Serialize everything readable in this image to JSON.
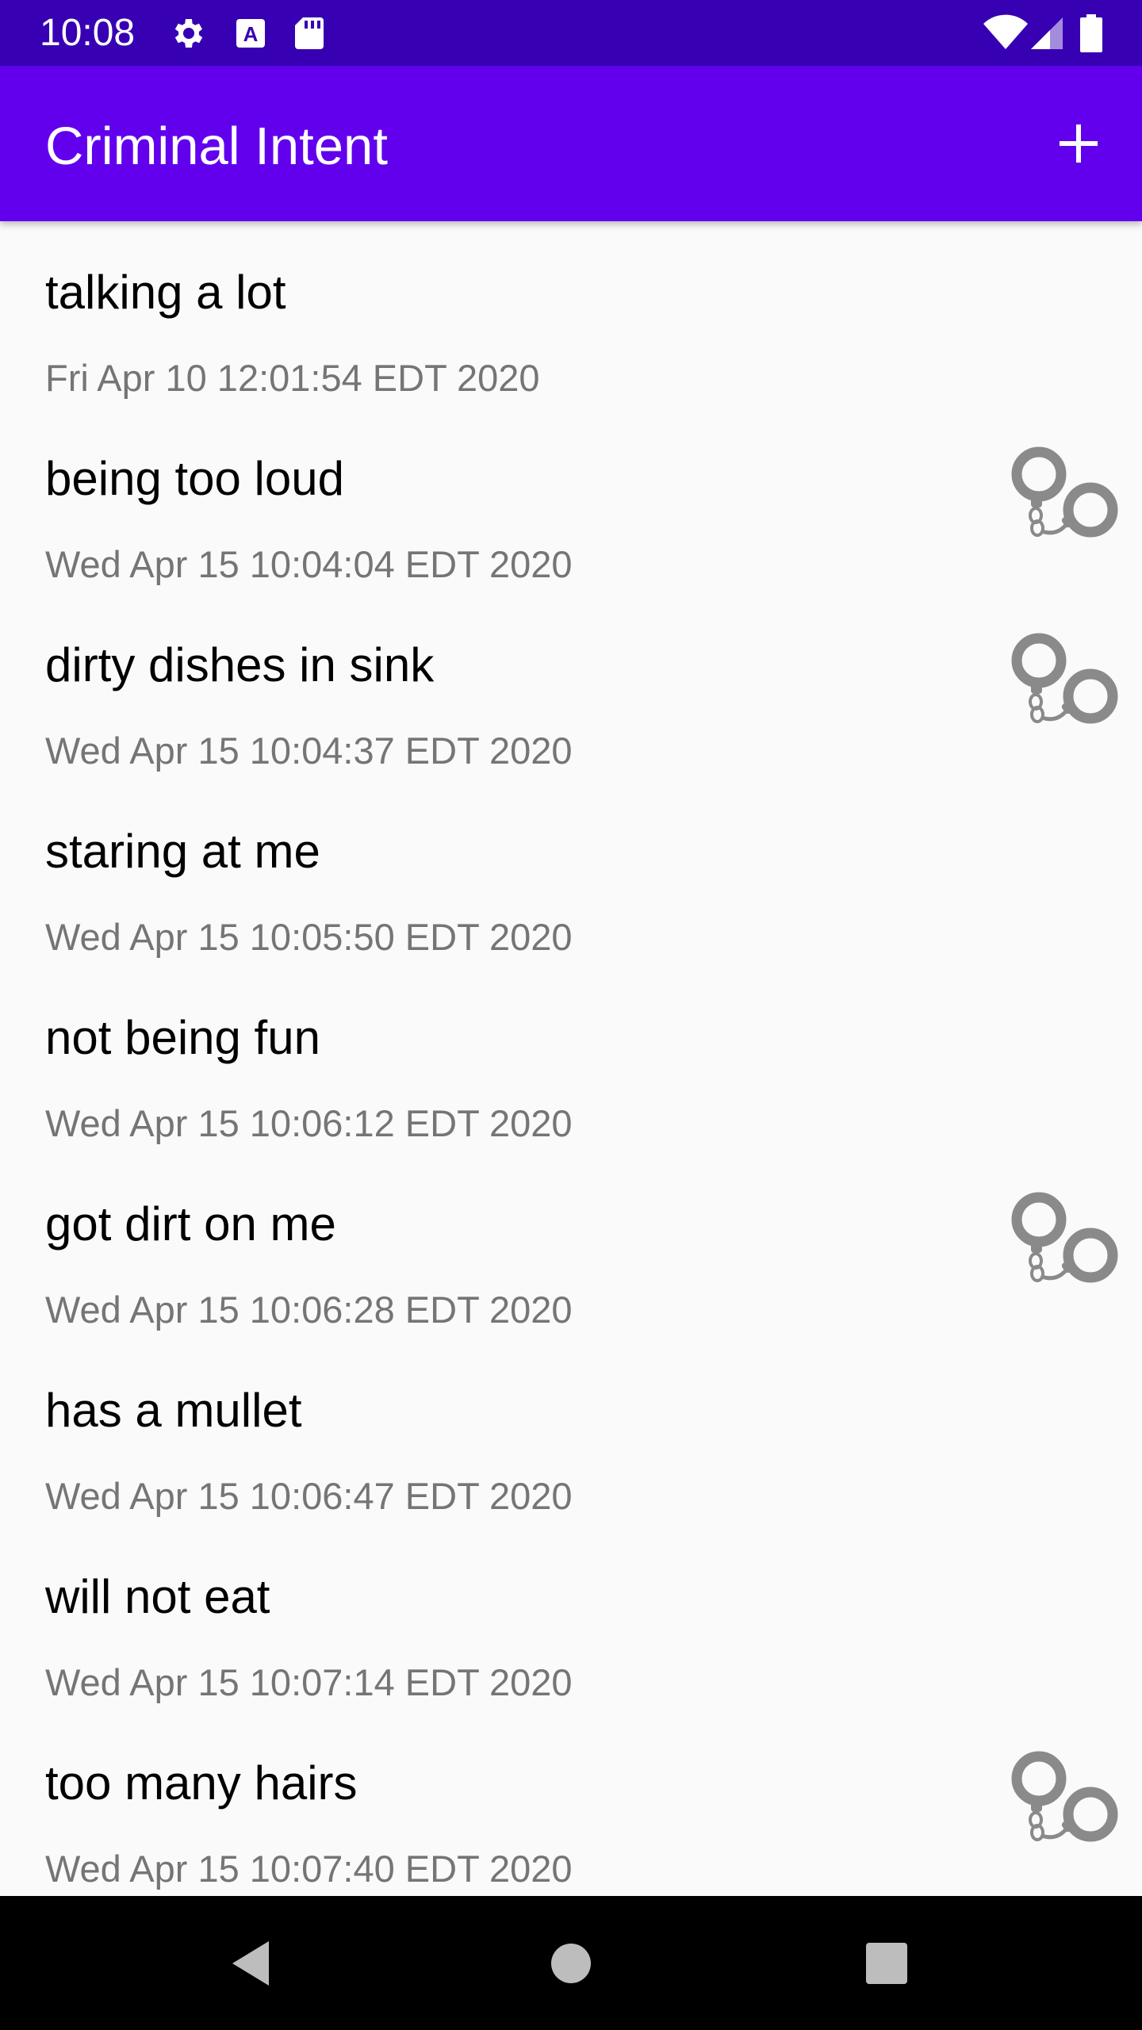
{
  "status_bar": {
    "time": "10:08",
    "left_icons": [
      "gear-icon",
      "text-icon",
      "sd-card-icon"
    ],
    "right_icons": [
      "wifi-icon",
      "signal-icon",
      "battery-icon"
    ]
  },
  "app_bar": {
    "title": "Criminal Intent",
    "add_icon": "plus-icon"
  },
  "crimes": [
    {
      "title": "talking a lot",
      "date": "Fri Apr 10 12:01:54 EDT 2020",
      "solved": false
    },
    {
      "title": "being too loud",
      "date": "Wed Apr 15 10:04:04 EDT 2020",
      "solved": true
    },
    {
      "title": "dirty dishes in sink",
      "date": "Wed Apr 15 10:04:37 EDT 2020",
      "solved": true
    },
    {
      "title": "staring at me",
      "date": "Wed Apr 15 10:05:50 EDT 2020",
      "solved": false
    },
    {
      "title": "not being fun",
      "date": "Wed Apr 15 10:06:12 EDT 2020",
      "solved": false
    },
    {
      "title": "got dirt on me",
      "date": "Wed Apr 15 10:06:28 EDT 2020",
      "solved": true
    },
    {
      "title": "has a mullet",
      "date": "Wed Apr 15 10:06:47 EDT 2020",
      "solved": false
    },
    {
      "title": "will not eat",
      "date": "Wed Apr 15 10:07:14 EDT 2020",
      "solved": false
    },
    {
      "title": "too many hairs",
      "date": "Wed Apr 15 10:07:40 EDT 2020",
      "solved": true
    }
  ],
  "colors": {
    "status_bar": "#3700b3",
    "app_bar": "#6200ee",
    "background": "#fafafa",
    "date_text": "#757575",
    "handcuff_icon": "#8a8a8a"
  },
  "nav_bar": {
    "icons": [
      "back-icon",
      "home-icon",
      "recents-icon"
    ]
  }
}
